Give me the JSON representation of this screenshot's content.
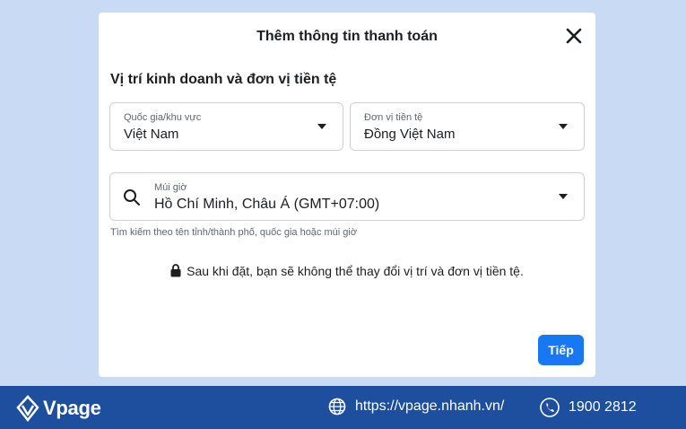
{
  "dialog": {
    "title": "Thêm thông tin thanh toán",
    "section_title": "Vị trí kinh doanh và đơn vị tiền tệ",
    "country": {
      "label": "Quốc gia/khu vực",
      "value": "Việt Nam"
    },
    "currency": {
      "label": "Đơn vị tiền tệ",
      "value": "Đồng Việt Nam"
    },
    "timezone": {
      "label": "Múi giờ",
      "value": "Hồ Chí Minh, Châu Á (GMT+07:00)"
    },
    "helper_text": "Tìm kiếm theo tên tỉnh/thành phố, quốc gia hoặc múi giờ",
    "notice": "Sau khi đặt, bạn sẽ không thể thay đổi vị trí và đơn vị tiền tệ.",
    "next_label": "Tiếp"
  },
  "footer": {
    "brand": "Vpage",
    "website": "https://vpage.nhanh.vn/",
    "phone": "1900 2812"
  },
  "colors": {
    "background": "#c9daf5",
    "primary_button": "#1877f2",
    "footer": "#1d4f9e"
  },
  "icons": [
    "close-icon",
    "search-icon",
    "lock-icon",
    "chevron-down-icon",
    "globe-icon",
    "phone-icon",
    "vpage-logo-icon"
  ]
}
